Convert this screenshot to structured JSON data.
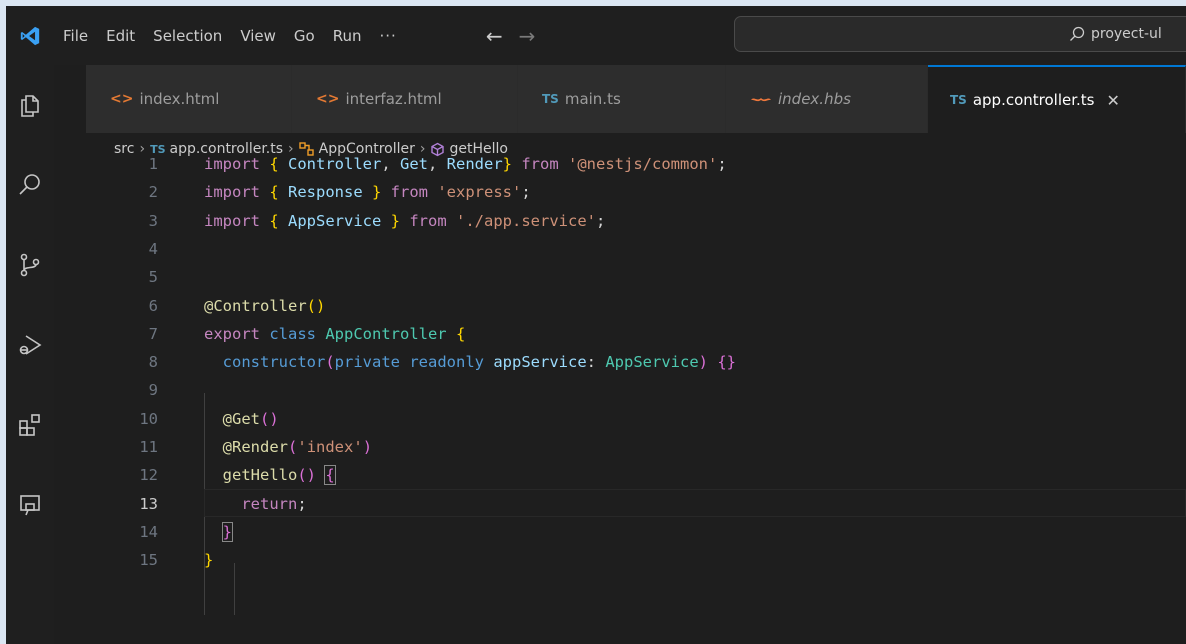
{
  "menu": [
    "File",
    "Edit",
    "Selection",
    "View",
    "Go",
    "Run",
    "···"
  ],
  "search": {
    "text": "proyect-ul"
  },
  "tabs": [
    {
      "label": "index.html",
      "icon": "html-icon"
    },
    {
      "label": "interfaz.html",
      "icon": "html-icon"
    },
    {
      "label": "main.ts",
      "icon": "ts-icon"
    },
    {
      "label": "index.hbs",
      "icon": "handlebars-icon"
    },
    {
      "label": "app.controller.ts",
      "icon": "ts-icon",
      "close": "✕"
    }
  ],
  "breadcrumb": {
    "folder": "src",
    "file": "app.controller.ts",
    "class": "AppController",
    "method": "getHello",
    "ts_badge": "TS"
  },
  "icons": {
    "ts_badge": "TS",
    "html_glyph": "<>"
  },
  "code": {
    "current_line": 13,
    "lines": [
      {
        "n": "1",
        "tokens": [
          [
            "import ",
            "k"
          ],
          [
            "{ ",
            "b1"
          ],
          [
            "Controller",
            "v"
          ],
          [
            ", ",
            "p"
          ],
          [
            "Get",
            "v"
          ],
          [
            ", ",
            "p"
          ],
          [
            "Render",
            "v"
          ],
          [
            "}",
            "b1"
          ],
          [
            " from ",
            "k"
          ],
          [
            "'@nestjs/common'",
            "s"
          ],
          [
            ";",
            "p"
          ]
        ]
      },
      {
        "n": "2",
        "tokens": [
          [
            "import ",
            "k"
          ],
          [
            "{ ",
            "b1"
          ],
          [
            "Response ",
            "v"
          ],
          [
            "}",
            "b1"
          ],
          [
            " from ",
            "k"
          ],
          [
            "'express'",
            "s"
          ],
          [
            ";",
            "p"
          ]
        ]
      },
      {
        "n": "3",
        "tokens": [
          [
            "import ",
            "k"
          ],
          [
            "{ ",
            "b1"
          ],
          [
            "AppService ",
            "v"
          ],
          [
            "}",
            "b1"
          ],
          [
            " from ",
            "k"
          ],
          [
            "'./app.service'",
            "s"
          ],
          [
            ";",
            "p"
          ]
        ]
      },
      {
        "n": "4",
        "tokens": []
      },
      {
        "n": "5",
        "tokens": []
      },
      {
        "n": "6",
        "tokens": [
          [
            "@",
            "f"
          ],
          [
            "Controller",
            "f"
          ],
          [
            "(",
            "b1"
          ],
          [
            ")",
            "b1"
          ]
        ]
      },
      {
        "n": "7",
        "tokens": [
          [
            "export ",
            "k"
          ],
          [
            "class ",
            "kb"
          ],
          [
            "AppController ",
            "t"
          ],
          [
            "{",
            "b1"
          ]
        ]
      },
      {
        "n": "8",
        "tokens": [
          [
            "  ",
            "p"
          ],
          [
            "constructor",
            "kb"
          ],
          [
            "(",
            "b2"
          ],
          [
            "private ",
            "kb"
          ],
          [
            "readonly ",
            "kb"
          ],
          [
            "appService",
            "v"
          ],
          [
            ": ",
            "p"
          ],
          [
            "AppService",
            "t"
          ],
          [
            ") ",
            "b2"
          ],
          [
            "{}",
            "b2"
          ]
        ]
      },
      {
        "n": "9",
        "tokens": []
      },
      {
        "n": "10",
        "tokens": [
          [
            "  ",
            "p"
          ],
          [
            "@",
            "f"
          ],
          [
            "Get",
            "f"
          ],
          [
            "()",
            "b2"
          ]
        ]
      },
      {
        "n": "11",
        "tokens": [
          [
            "  ",
            "p"
          ],
          [
            "@",
            "f"
          ],
          [
            "Render",
            "f"
          ],
          [
            "(",
            "b2"
          ],
          [
            "'index'",
            "s"
          ],
          [
            ")",
            "b2"
          ]
        ]
      },
      {
        "n": "12",
        "tokens": [
          [
            "  ",
            "p"
          ],
          [
            "getHello",
            "f"
          ],
          [
            "() ",
            "b2"
          ],
          [
            "{",
            "b2 bm"
          ]
        ]
      },
      {
        "n": "13",
        "tokens": [
          [
            "    ",
            "p"
          ],
          [
            "return",
            "k"
          ],
          [
            ";",
            "p"
          ]
        ]
      },
      {
        "n": "14",
        "tokens": [
          [
            "  ",
            "p"
          ],
          [
            "}",
            "b2 bm"
          ]
        ]
      },
      {
        "n": "15",
        "tokens": [
          [
            "}",
            "b1"
          ]
        ]
      }
    ]
  }
}
